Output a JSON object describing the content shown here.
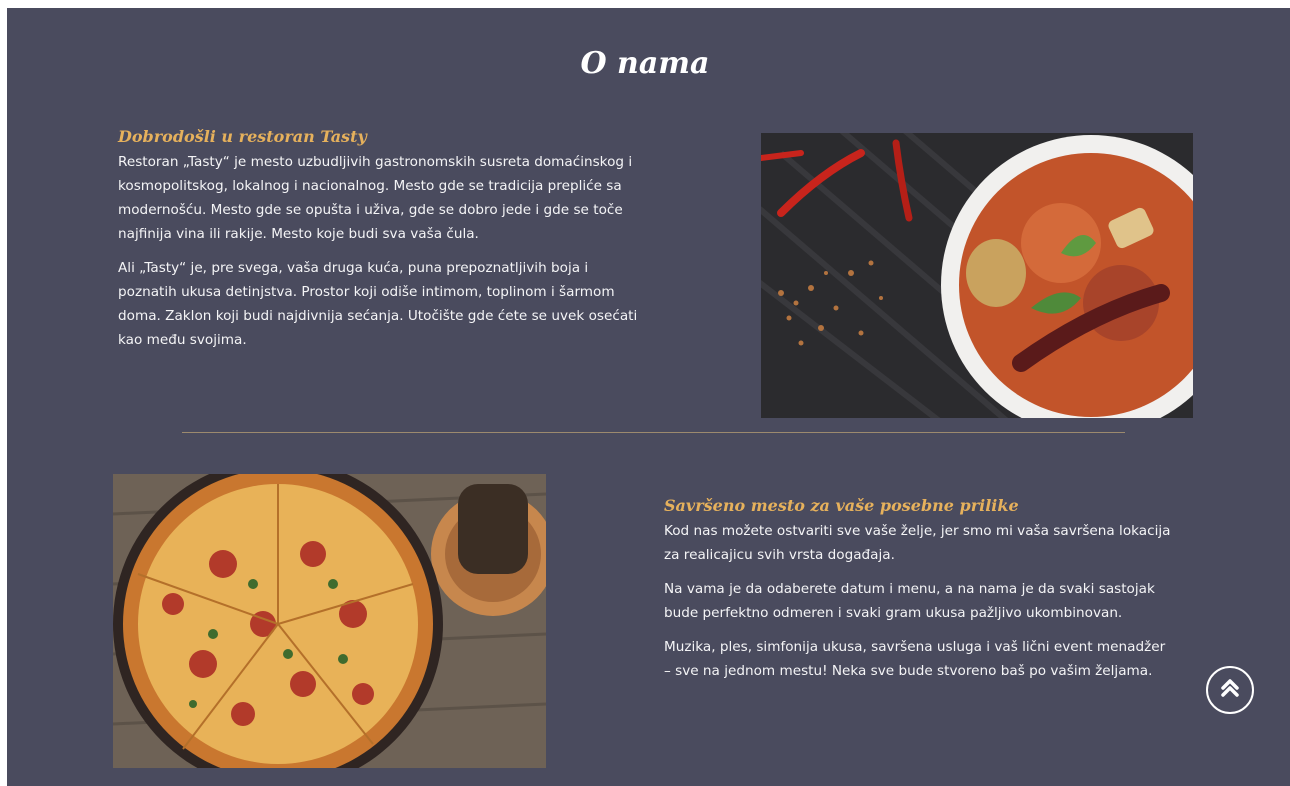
{
  "section": {
    "title": "O nama"
  },
  "block1": {
    "heading": "Dobrodošli u restoran Tasty",
    "paragraphs": [
      "Restoran „Tasty“ je mesto uzbudljivih gastronomskih susreta domaćinskog i kosmopolitskog, lokalnog i nacionalnog. Mesto gde se tradicija prepliće sa modernošću. Mesto gde se opušta i uživa, gde se dobro jede i gde se toče najfinija vina ili rakije. Mesto koje budi sva vaša čula.",
      "Ali „Tasty“ je, pre svega, vaša druga kuća, puna prepoznatljivih boja i poznatih ukusa detinjstva. Prostor koji odiše intimom, toplinom i šarmom doma. Zaklon koji budi najdivnija sećanja. Utočište gde ćete se uvek osećati kao među svojima."
    ]
  },
  "block2": {
    "heading": "Savršeno mesto za vaše posebne prilike",
    "paragraphs": [
      "Kod nas možete ostvariti sve vaše želje, jer smo mi vaša savršena lokacija za realicajicu svih vrsta događaja.",
      "Na vama je da odaberete datum i menu, a na nama je da svaki sastojak bude perfektno odmeren i svaki gram ukusa pažljivo ukombinovan.",
      "Muzika, ples, simfonija ukusa, savršena usluga i vaš lični event menadžer – sve na jednom mestu! Neka sve bude stvoreno baš po vašim željama."
    ]
  },
  "images": {
    "top_right": "curry-photo",
    "bottom_left": "pizza-photo"
  },
  "scroll_top": {
    "icon": "double-chevron-up-icon"
  },
  "colors": {
    "background": "#4a4b5e",
    "accent": "#e6b15c",
    "text": "#ffffff",
    "divider": "#9c8a6e"
  }
}
